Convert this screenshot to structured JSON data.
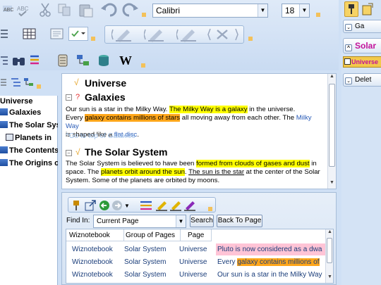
{
  "toolbar": {
    "font_name": "Calibri",
    "font_size": "18",
    "icons": [
      "spellcheck-icon",
      "cut-icon",
      "copy-icon",
      "paste-icon",
      "undo-icon",
      "redo-icon"
    ]
  },
  "tree": {
    "items": [
      {
        "label": "Universe",
        "indent": 0
      },
      {
        "label": "Galaxies",
        "indent": 1
      },
      {
        "label": "The Solar Sys",
        "indent": 1
      },
      {
        "label": "Planets in",
        "indent": 2
      },
      {
        "label": "The Contents",
        "indent": 1
      },
      {
        "label": "The Origins o",
        "indent": 1
      }
    ]
  },
  "note": {
    "title_universe": "Universe",
    "title_galaxies": "Galaxies",
    "galaxies_text_1": "Our sun is a star in the Milky Way. ",
    "galaxies_hl_1": "The Milky Way is a galaxy",
    "galaxies_text_2": " in the universe.",
    "galaxies_text_3": "Every ",
    "galaxies_hl_2": "galaxy contains millions of stars",
    "galaxies_text_4": " all moving away from each other. The ",
    "galaxies_link_1": "Milky Way",
    "galaxies_text_5": " is shaped like a ",
    "galaxies_link_2": "flat disc",
    "galaxies_text_6": ".",
    "goto_top": "Go to top of Galaxies",
    "title_solar": "The Solar System",
    "solar_text_1": "The Solar System is believed to have been ",
    "solar_hl_1": "formed from clouds of gases and dust",
    "solar_text_2": " in space. The ",
    "solar_hl_2": "planets orbit around the sun",
    "solar_text_3": ". ",
    "solar_underline": "The sun is the star",
    "solar_text_4": " at the center of the Solar System. Some of the planets are orbited by moons."
  },
  "search_panel": {
    "find_in_label": "Find In:",
    "find_in_value": "Current Page",
    "search_button": "Search",
    "back_button": "Back To Page",
    "columns": [
      "Wiznotebook",
      "Group of Pages",
      "Page"
    ],
    "rows": [
      {
        "notebook": "Wiznotebook",
        "group": "Solar System",
        "page": "Universe",
        "text": "Pluto is now considered as a dwa",
        "hl": "pink"
      },
      {
        "notebook": "Wiznotebook",
        "group": "Solar System",
        "page": "Universe",
        "text_pre": "Every ",
        "text": "galaxy contains millions of",
        "hl": "orange"
      },
      {
        "notebook": "Wiznotebook",
        "group": "Solar System",
        "page": "Universe",
        "text": "Our sun is a star in the Milky Way",
        "hl": "none"
      }
    ]
  },
  "right_panel": {
    "item_ga": "Ga",
    "item_solar": "Solar",
    "item_universe": "Universe",
    "item_delete": "Delet"
  },
  "colors": {
    "highlight_yellow": "#ffff00",
    "highlight_orange": "#ffa61a",
    "highlight_pink": "#ffc4d6",
    "link_blue": "#2a5cb8",
    "solar_magenta": "#c3129a"
  }
}
